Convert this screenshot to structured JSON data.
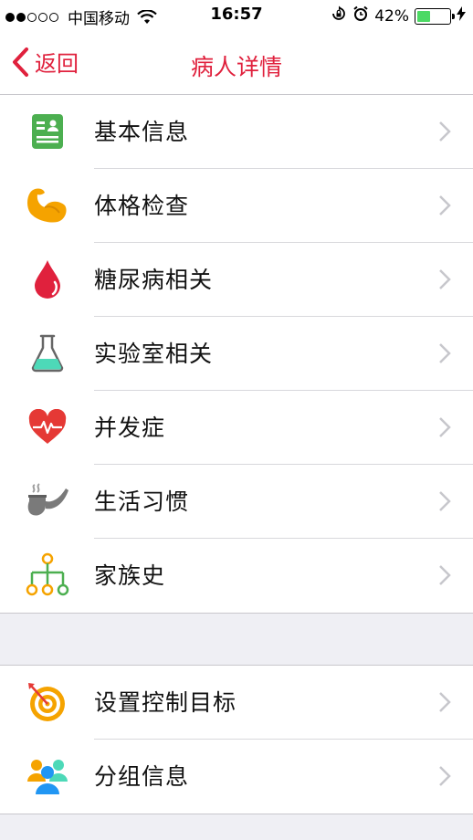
{
  "status_bar": {
    "carrier": "中国移动",
    "time": "16:57",
    "battery_percent": "42%",
    "battery_level": 0.42,
    "signal_bars_filled": 2,
    "signal_bars_total": 5
  },
  "nav": {
    "back_label": "返回",
    "title": "病人详情"
  },
  "colors": {
    "accent": "#e0213d",
    "background": "#efeff4"
  },
  "menu_group_1": [
    {
      "label": "基本信息",
      "icon": "profile-card-icon"
    },
    {
      "label": "体格检查",
      "icon": "flexed-arm-icon"
    },
    {
      "label": "糖尿病相关",
      "icon": "blood-drop-icon"
    },
    {
      "label": "实验室相关",
      "icon": "lab-flask-icon"
    },
    {
      "label": "并发症",
      "icon": "heartbeat-icon"
    },
    {
      "label": "生活习惯",
      "icon": "pipe-icon"
    },
    {
      "label": "家族史",
      "icon": "family-tree-icon"
    }
  ],
  "menu_group_2": [
    {
      "label": "设置控制目标",
      "icon": "target-icon"
    },
    {
      "label": "分组信息",
      "icon": "group-users-icon"
    }
  ]
}
